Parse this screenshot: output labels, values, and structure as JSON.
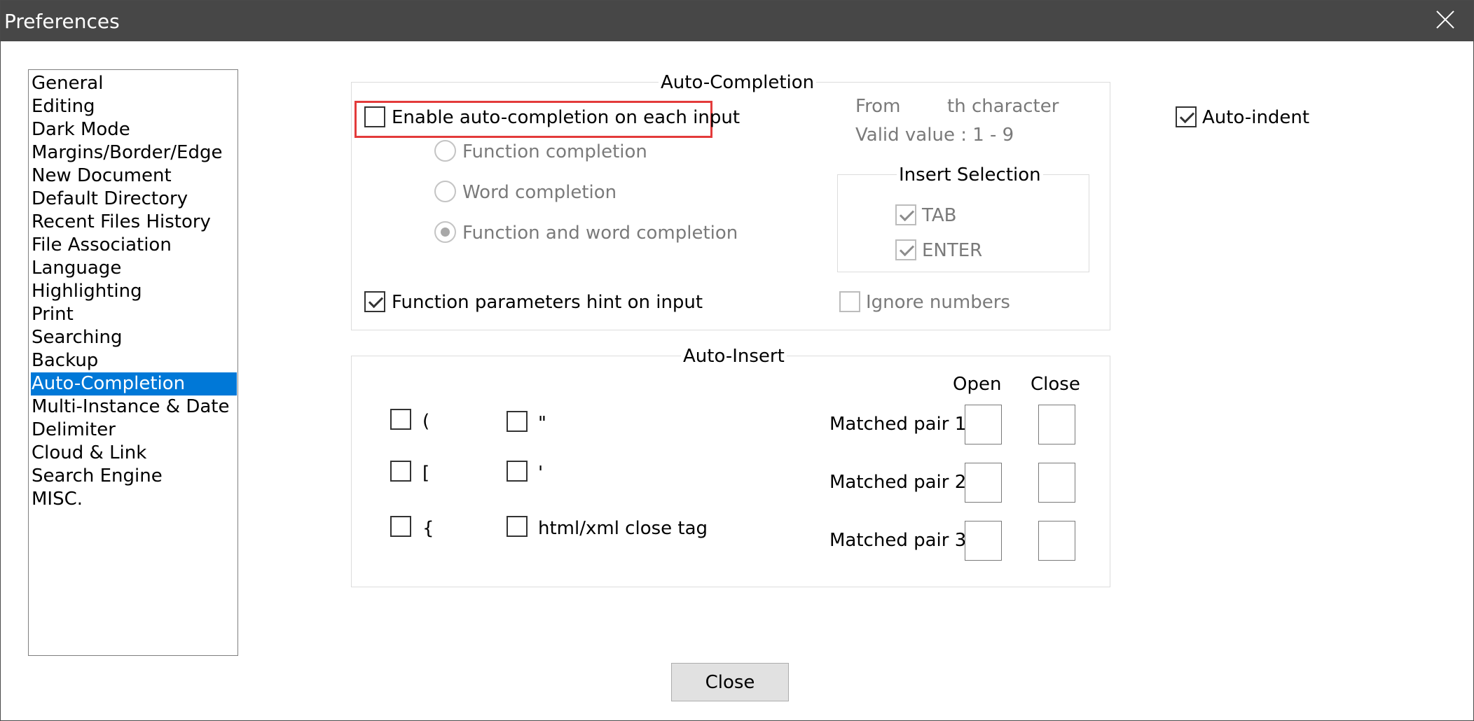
{
  "window": {
    "title": "Preferences"
  },
  "sidebar": {
    "items": [
      {
        "label": "General"
      },
      {
        "label": "Editing"
      },
      {
        "label": "Dark Mode"
      },
      {
        "label": "Margins/Border/Edge"
      },
      {
        "label": "New Document"
      },
      {
        "label": "Default Directory"
      },
      {
        "label": "Recent Files History"
      },
      {
        "label": "File Association"
      },
      {
        "label": "Language"
      },
      {
        "label": "Highlighting"
      },
      {
        "label": "Print"
      },
      {
        "label": "Searching"
      },
      {
        "label": "Backup"
      },
      {
        "label": "Auto-Completion",
        "selected": true
      },
      {
        "label": "Multi-Instance & Date"
      },
      {
        "label": "Delimiter"
      },
      {
        "label": "Cloud & Link"
      },
      {
        "label": "Search Engine"
      },
      {
        "label": "MISC."
      }
    ]
  },
  "auto_completion": {
    "title": "Auto-Completion",
    "enable_label": "Enable auto-completion on each input",
    "enable_checked": false,
    "radios": [
      {
        "label": "Function completion",
        "selected": false
      },
      {
        "label": "Word completion",
        "selected": false
      },
      {
        "label": "Function and word completion",
        "selected": true
      }
    ],
    "from_label": "From",
    "th_label": "th character",
    "valid_label": "Valid value : 1 - 9",
    "insert_selection": {
      "title": "Insert Selection",
      "tab_label": "TAB",
      "tab_checked": true,
      "enter_label": "ENTER",
      "enter_checked": true
    },
    "param_hint_label": "Function parameters hint on input",
    "param_hint_checked": true,
    "ignore_numbers_label": "Ignore numbers",
    "ignore_numbers_checked": false
  },
  "auto_indent": {
    "label": "Auto-indent",
    "checked": true
  },
  "auto_insert": {
    "title": "Auto-Insert",
    "left_items": [
      {
        "label": "(",
        "checked": false
      },
      {
        "label": "[",
        "checked": false
      },
      {
        "label": "{",
        "checked": false
      }
    ],
    "right_items": [
      {
        "label": "\"",
        "checked": false
      },
      {
        "label": "'",
        "checked": false
      },
      {
        "label": "html/xml close tag",
        "checked": false
      }
    ],
    "open_header": "Open",
    "close_header": "Close",
    "pairs": [
      {
        "label": "Matched pair 1:",
        "open": "",
        "close": ""
      },
      {
        "label": "Matched pair 2:",
        "open": "",
        "close": ""
      },
      {
        "label": "Matched pair 3:",
        "open": "",
        "close": ""
      }
    ]
  },
  "footer": {
    "close_label": "Close"
  }
}
